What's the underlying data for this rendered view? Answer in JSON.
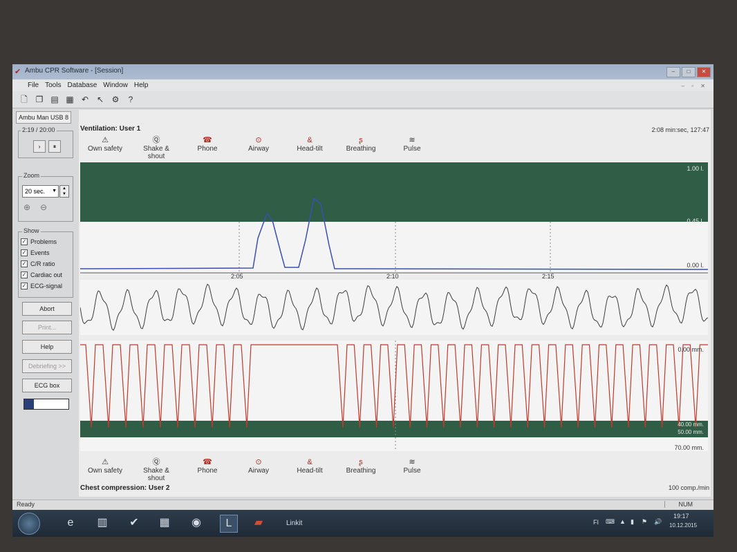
{
  "window": {
    "title": "Ambu CPR Software - [Session]",
    "menu": [
      "File",
      "Tools",
      "Database",
      "Window",
      "Help"
    ]
  },
  "left": {
    "device_tab": "Ambu Man USB 8",
    "timer": "2:19 / 20:00",
    "play": "›",
    "pause": "⏸",
    "zoom_title": "Zoom",
    "zoom_value": "20 sec.",
    "show_title": "Show",
    "show_items": [
      "Problems",
      "Events",
      "C/R ratio",
      "Cardiac out",
      "ECG-signal"
    ],
    "buttons": [
      "Abort",
      "Print...",
      "Help",
      "Debriefing >>",
      "ECG box"
    ]
  },
  "ventilation": {
    "title": "Ventilation: User 1",
    "right_label": "2:08 min:sec, 127:47",
    "top_value": "1.00 l.",
    "mid_value": "0.45 l.",
    "bottom_value": "0.00 l.",
    "ticks": [
      "2:05",
      "2:10",
      "2:15"
    ]
  },
  "steps": {
    "items": [
      {
        "label": "Own safety",
        "icon": "warning-icon"
      },
      {
        "label": "Shake & shout",
        "icon": "question-circle-icon"
      },
      {
        "label": "Phone",
        "icon": "phone-icon"
      },
      {
        "label": "Airway",
        "icon": "airway-icon"
      },
      {
        "label": "Head-tilt",
        "icon": "head-tilt-icon"
      },
      {
        "label": "Breathing",
        "icon": "breathing-icon"
      },
      {
        "label": "Pulse",
        "icon": "pulse-icon"
      }
    ]
  },
  "compression": {
    "title": "Chest compression: User 2",
    "top_value": "0.00 mm.",
    "band_value1": "40.00 mm.",
    "band_value2": "50.00 mm.",
    "bottom_value": "70.00 mm.",
    "rate_label": "100 comp./min"
  },
  "status": {
    "left": "Ready",
    "right": "NUM"
  },
  "taskbar": {
    "app_label": "Linkit",
    "lang": "FI",
    "time": "19:17",
    "date": "10.12.2015"
  },
  "colors": {
    "green_band": "#2f5d46",
    "ventilation_line": "#3a4fb0",
    "ecg_line": "#3c3c3c",
    "compression_line": "#c0392b"
  }
}
